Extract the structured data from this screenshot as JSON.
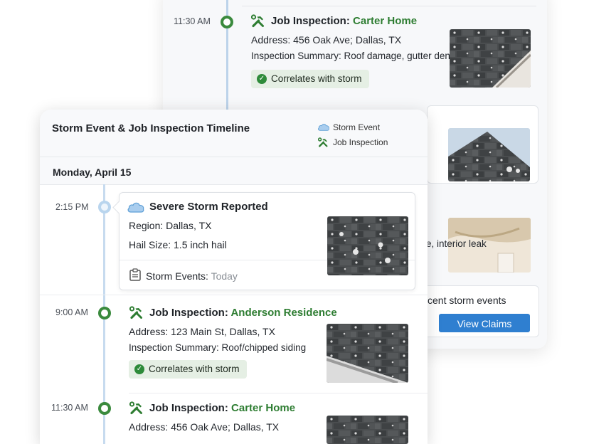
{
  "back": {
    "entry": {
      "time": "11:30 AM",
      "title_prefix": "Job Inspection: ",
      "place": "Carter Home",
      "address": "Address: 456 Oak Ave; Dallas, TX",
      "summary": "Inspection Summary: Roof damage, gutter dents",
      "badge": "Correlates with storm"
    },
    "partial_text": "e, interior leak",
    "claims_text": "cent storm events",
    "view_claims": "View Claims"
  },
  "front": {
    "title": "Storm Event & Job Inspection Timeline",
    "legend": [
      {
        "icon": "cloud-icon",
        "label": "Storm Event"
      },
      {
        "icon": "wrench-hammer-icon",
        "label": "Job Inspection"
      }
    ],
    "date": "Monday, April 15",
    "storm": {
      "time": "2:15 PM",
      "title": "Severe Storm Reported",
      "region": "Region: Dallas,  TX",
      "hail": "Hail Size: 1.5 inch hail",
      "footer_label": "Storm Events: ",
      "footer_value": "Today"
    },
    "jobs": [
      {
        "time": "9:00 AM",
        "title_prefix": "Job Inspection: ",
        "place": "Anderson Residence",
        "address": "Address: 123 Main St, Dallas, TX",
        "summary": "Inspection Summary: Roof/chipped siding",
        "badge": "Correlates with storm"
      },
      {
        "time": "11:30 AM",
        "title_prefix": "Job Inspection: ",
        "place": "Carter Home",
        "address": "Address: 456 Oak Ave; Dallas, TX"
      }
    ]
  },
  "colors": {
    "accent_green": "#2e7d32",
    "timeline_blue": "#c7dbef",
    "button_blue": "#2f7fd0",
    "badge_bg": "#e5efe4"
  }
}
